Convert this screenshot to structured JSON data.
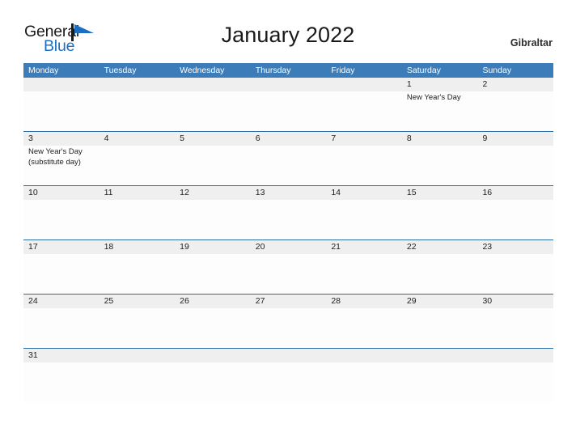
{
  "brand": {
    "name_part1": "General",
    "name_part2": "Blue",
    "flag_icon": "flag-triangle-icon",
    "accent_color": "#1b6ec2"
  },
  "header": {
    "title": "January 2022",
    "region": "Gibraltar"
  },
  "theme": {
    "header_blue": "#3c7cb8",
    "rule_blue": "#2c6da4",
    "date_band_gray": "#efefef",
    "cell_white": "#fdfdfd"
  },
  "calendar": {
    "day_headers": [
      "Monday",
      "Tuesday",
      "Wednesday",
      "Thursday",
      "Friday",
      "Saturday",
      "Sunday"
    ],
    "weeks": [
      {
        "dates": [
          "",
          "",
          "",
          "",
          "",
          "1",
          "2"
        ],
        "events": [
          [],
          [],
          [],
          [],
          [],
          [
            "New Year's Day"
          ],
          []
        ]
      },
      {
        "dates": [
          "3",
          "4",
          "5",
          "6",
          "7",
          "8",
          "9"
        ],
        "events": [
          [
            "New Year's Day",
            "(substitute day)"
          ],
          [],
          [],
          [],
          [],
          [],
          []
        ]
      },
      {
        "dates": [
          "10",
          "11",
          "12",
          "13",
          "14",
          "15",
          "16"
        ],
        "events": [
          [],
          [],
          [],
          [],
          [],
          [],
          []
        ]
      },
      {
        "dates": [
          "17",
          "18",
          "19",
          "20",
          "21",
          "22",
          "23"
        ],
        "events": [
          [],
          [],
          [],
          [],
          [],
          [],
          []
        ]
      },
      {
        "dates": [
          "24",
          "25",
          "26",
          "27",
          "28",
          "29",
          "30"
        ],
        "events": [
          [],
          [],
          [],
          [],
          [],
          [],
          []
        ]
      },
      {
        "dates": [
          "31",
          "",
          "",
          "",
          "",
          "",
          ""
        ],
        "events": [
          [],
          [],
          [],
          [],
          [],
          [],
          []
        ]
      }
    ]
  }
}
